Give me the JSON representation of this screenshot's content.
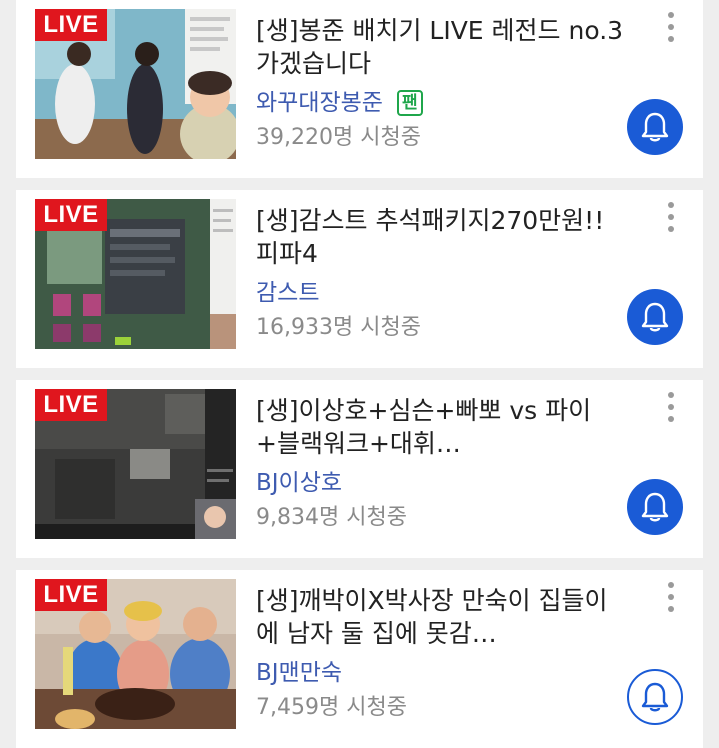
{
  "live_label": "LIVE",
  "accent_color": "#1a5bd6",
  "live_color": "#e0161e",
  "streams": [
    {
      "title": "[생]봉준 배치기 LIVE 레전드 no.3 가겠습니다",
      "channel": "와꾸대장봉준",
      "fan_badge": "팬",
      "viewers": "39,220명 시청중",
      "bell_state": "filled"
    },
    {
      "title": "[생]감스트 추석패키지270만원!! 피파4",
      "channel": "감스트",
      "viewers": "16,933명 시청중",
      "bell_state": "filled"
    },
    {
      "title": "[생]이상호+심슨+빠뽀 vs 파이+블랙워크+대휘…",
      "channel": "BJ이상호",
      "viewers": "9,834명 시청중",
      "bell_state": "filled"
    },
    {
      "title": "[생]깨박이X박사장 만숙이 집들이에 남자 둘 집에 못감…",
      "channel": "BJ맨만숙",
      "viewers": "7,459명 시청중",
      "bell_state": "outline"
    }
  ]
}
